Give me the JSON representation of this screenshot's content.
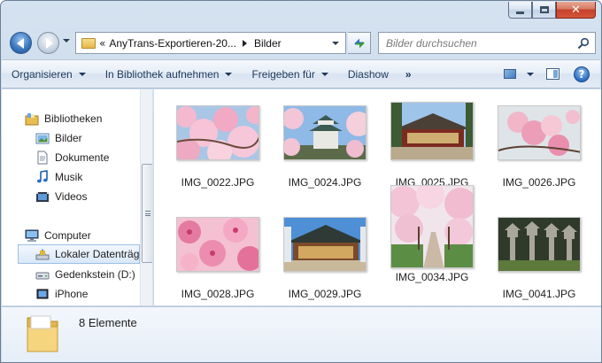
{
  "window": {
    "caption_buttons": [
      "minimize",
      "maximize",
      "close"
    ],
    "close_glyph": "✕"
  },
  "navigation": {
    "back_icon": "back-arrow-icon",
    "forward_icon": "forward-arrow-icon"
  },
  "address_bar": {
    "overflow_glyph": "«",
    "segments": [
      "AnyTrans-Exportieren-20...",
      "Bilder"
    ]
  },
  "search": {
    "placeholder": "Bilder durchsuchen"
  },
  "command_bar": {
    "organize": "Organisieren",
    "include_library": "In Bibliothek aufnehmen",
    "share": "Freigeben für",
    "slideshow": "Diashow",
    "more": "»",
    "help": "?"
  },
  "nav_pane": {
    "libraries": "Bibliotheken",
    "library_items": [
      "Bilder",
      "Dokumente",
      "Musik",
      "Videos"
    ],
    "computer": "Computer",
    "computer_items": [
      "Lokaler Datenträger (C:)",
      "Gedenkstein (D:)",
      "iPhone"
    ],
    "selected_index": 0
  },
  "files": [
    {
      "name": "IMG_0022.JPG",
      "subject": "cherry-blossom"
    },
    {
      "name": "IMG_0024.JPG",
      "subject": "castle"
    },
    {
      "name": "IMG_0025.JPG",
      "subject": "temple"
    },
    {
      "name": "IMG_0026.JPG",
      "subject": "blossom-closeup"
    },
    {
      "name": "IMG_0028.JPG",
      "subject": "pink-blossoms"
    },
    {
      "name": "IMG_0029.JPG",
      "subject": "shrine"
    },
    {
      "name": "IMG_0034.JPG",
      "subject": "blossom-path"
    },
    {
      "name": "IMG_0041.JPG",
      "subject": "stone-lanterns"
    }
  ],
  "details": {
    "count": "8 Elemente"
  },
  "colors": {
    "accent": "#1e395b",
    "selection": "#d9e8f8",
    "frame": "#cddbea"
  }
}
